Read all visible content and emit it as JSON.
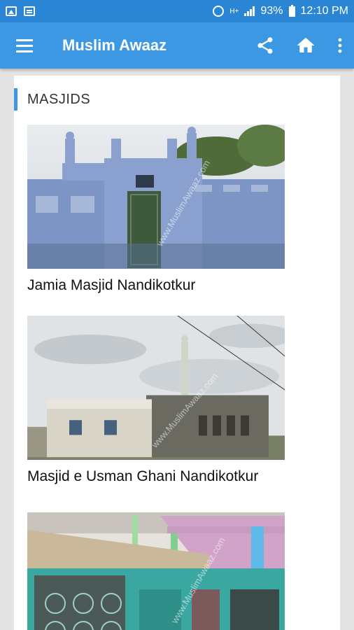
{
  "status_bar": {
    "battery": "93%",
    "time": "12:10 PM",
    "network": "H+",
    "icons": [
      "image-icon",
      "message-icon",
      "alarm-icon",
      "signal-icon",
      "battery-icon"
    ]
  },
  "app_bar": {
    "title": "Muslim Awaaz",
    "menu_icon": "hamburger-menu-icon",
    "actions": [
      "share-icon",
      "home-icon",
      "more-vert-icon"
    ]
  },
  "colors": {
    "status_bar": "#2a86d4",
    "app_bar": "#3d98e3",
    "accent": "#3d98e3",
    "background": "#e4e4e4"
  },
  "section": {
    "title": "MASJIDS"
  },
  "masjids": [
    {
      "name": "Jamia Masjid Nandikotkur",
      "watermark": "www.MuslimAwaaz.com"
    },
    {
      "name": "Masjid e Usman Ghani Nandikotkur",
      "watermark": "www.MuslimAwaaz.com"
    },
    {
      "name": "",
      "watermark": "www.MuslimAwaaz.com"
    }
  ]
}
